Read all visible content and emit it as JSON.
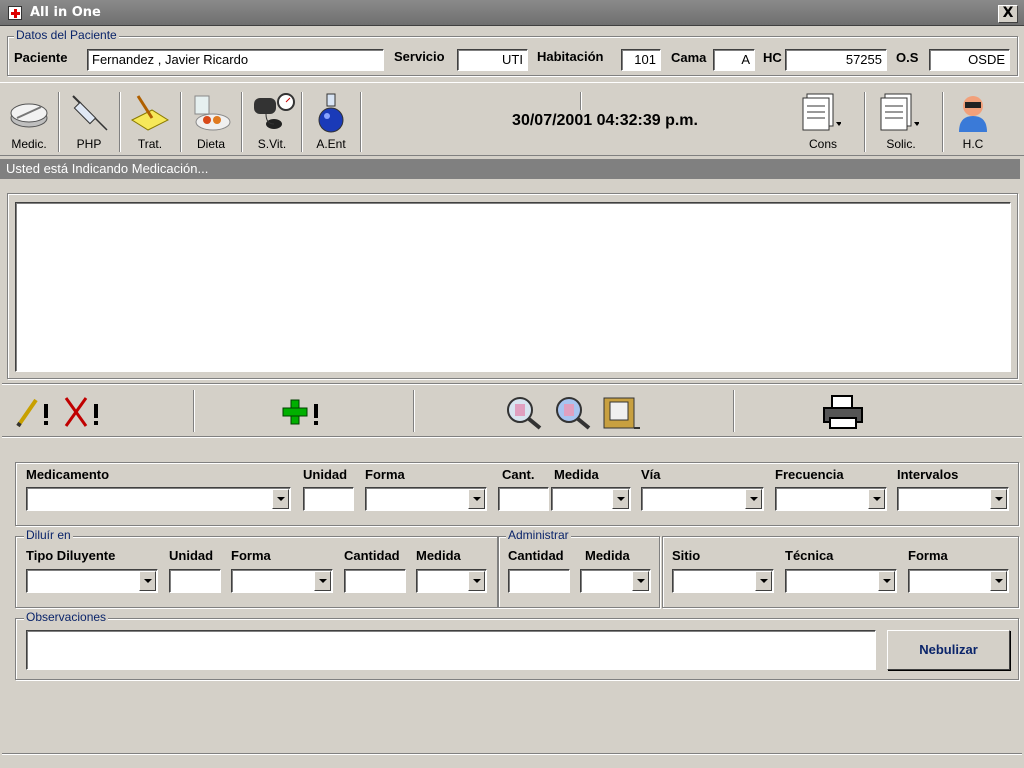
{
  "window": {
    "title": "All in One",
    "close_label": "X"
  },
  "patient": {
    "legend": "Datos del Paciente",
    "paciente_label": "Paciente",
    "paciente_value": "Fernandez , Javier Ricardo",
    "servicio_label": "Servicio",
    "servicio_value": "UTI",
    "habitacion_label": "Habitación",
    "habitacion_value": "101",
    "cama_label": "Cama",
    "cama_value": "A",
    "hc_label": "HC",
    "hc_value": "57255",
    "os_label": "O.S",
    "os_value": "OSDE"
  },
  "toolbar": {
    "buttons": [
      {
        "label": "Medic.",
        "icon": "pill-icon"
      },
      {
        "label": "PHP",
        "icon": "syringe-icon"
      },
      {
        "label": "Trat.",
        "icon": "note-pencil-icon"
      },
      {
        "label": "Dieta",
        "icon": "food-tray-icon"
      },
      {
        "label": "S.Vit.",
        "icon": "blood-pressure-icon"
      },
      {
        "label": "A.Ent",
        "icon": "flask-icon"
      },
      {
        "label": "Cons",
        "icon": "document-stack-icon"
      },
      {
        "label": "Solic.",
        "icon": "document-stack-icon"
      },
      {
        "label": "H.C",
        "icon": "doctor-icon"
      }
    ],
    "datetime": "30/07/2001 04:32:39 p.m."
  },
  "status": {
    "text": "Usted está Indicando Medicación..."
  },
  "actions": {
    "edit_icon": "pencil-exclaim-icon",
    "delete_icon": "red-x-exclaim-icon",
    "add_icon": "green-plus-exclaim-icon",
    "print_icon": "printer-icon",
    "colors": {
      "add": "#00b000",
      "delete": "#c00000"
    }
  },
  "medication": {
    "medicamento_label": "Medicamento",
    "unidad_label": "Unidad",
    "forma_label": "Forma",
    "cant_label": "Cant.",
    "medida_label": "Medida",
    "via_label": "Vía",
    "frecuencia_label": "Frecuencia",
    "intervalos_label": "Intervalos"
  },
  "diluir": {
    "legend": "Diluír en",
    "tipo_label": "Tipo Diluyente",
    "unidad_label": "Unidad",
    "forma_label": "Forma",
    "cantidad_label": "Cantidad",
    "medida_label": "Medida"
  },
  "administrar": {
    "legend": "Administrar",
    "cantidad_label": "Cantidad",
    "medida_label": "Medida",
    "sitio_label": "Sitio",
    "tecnica_label": "Técnica",
    "forma_label": "Forma"
  },
  "observaciones": {
    "legend": "Observaciones",
    "value": ""
  },
  "nebulizar_label": "Nebulizar"
}
